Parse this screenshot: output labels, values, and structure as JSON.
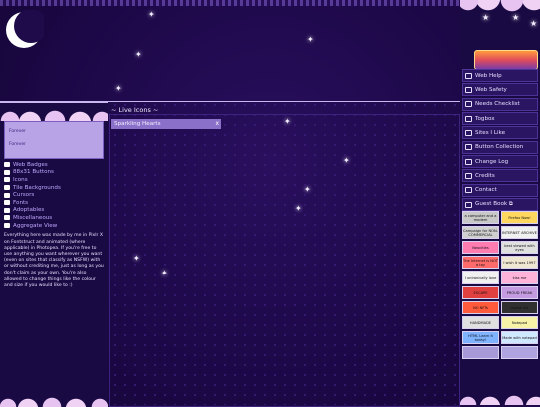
{
  "stamps": {
    "line1": "Forever",
    "line2": "Forever"
  },
  "left": {
    "links": [
      {
        "label": "Web Badges"
      },
      {
        "label": "88x31 Buttons"
      },
      {
        "label": "Icons"
      },
      {
        "label": "Tile Backgrounds"
      },
      {
        "label": "Cursors"
      },
      {
        "label": "Fonts"
      },
      {
        "label": "Adoptables"
      },
      {
        "label": "Miscellaneous"
      },
      {
        "label": "Aggregate View"
      }
    ],
    "description": "Everything here was made by me in Pixlr X on Fontstruct and animated (where applicable) in Photopea. If you're free to use anything you want wherever you want (even on sites that classify as NSFW) with or without crediting me, just as long as you don't claim as your own. You're also allowed to change things like the colour and size if you would like to :)"
  },
  "center": {
    "title": "~ Live Icons ~",
    "tab_label": "Sparkling Hearts",
    "tab_close": "x"
  },
  "nav": {
    "items": [
      {
        "label": "Web Help"
      },
      {
        "label": "Web Safety"
      },
      {
        "label": "Needs Checklist"
      },
      {
        "label": "Togbox"
      },
      {
        "label": "Sites I Like"
      },
      {
        "label": "Button Collection"
      },
      {
        "label": "Change Log"
      },
      {
        "label": "Credits"
      },
      {
        "label": "Contact"
      },
      {
        "label": "Guest Book ⧉"
      }
    ]
  },
  "buttons88": [
    {
      "text": "a computer and a modem",
      "bg": "#c8c8c8"
    },
    {
      "text": "Firefox Now!",
      "bg": "#ffd75e"
    },
    {
      "text": "Campaign for NON-COMMERCIAL",
      "bg": "#d0d0d0"
    },
    {
      "text": "INTERNET ARCHIVE",
      "bg": "#f0f0f0"
    },
    {
      "text": "Neocities",
      "bg": "#ff7bb0"
    },
    {
      "text": "best viewed with eyes",
      "bg": "#e0e0e0"
    },
    {
      "text": "The Internet is NOT a toy",
      "bg": "#ff6a6a"
    },
    {
      "text": "I wish it was 1997",
      "bg": "#f0e7d2"
    },
    {
      "text": "I unironically love",
      "bg": "#f0f0f0"
    },
    {
      "text": "kiss me",
      "bg": "#ffb3d9"
    },
    {
      "text": "ESCAPE",
      "bg": "#e04040"
    },
    {
      "text": "PROUD FREAK",
      "bg": "#c49ae0"
    },
    {
      "text": "NO NFTs",
      "bg": "#ff5a3c"
    },
    {
      "text": "Digital Art",
      "bg": "#303030"
    },
    {
      "text": "HANDMADE",
      "bg": "#e0e0e0"
    },
    {
      "text": "Notepad",
      "bg": "#f6f2a8"
    },
    {
      "text": "HTML Learn it today!",
      "bg": "#7fb2ff"
    },
    {
      "text": "Made with notepad",
      "bg": "#d0e8ff"
    },
    {
      "text": "",
      "bg": "#a89ad8"
    },
    {
      "text": "",
      "bg": "#b0a4e0"
    }
  ],
  "colors": {
    "background": "#1f0a4a",
    "panel": "#1a0a43",
    "accent": "#8a70c8",
    "link": "#bfa8ff"
  }
}
